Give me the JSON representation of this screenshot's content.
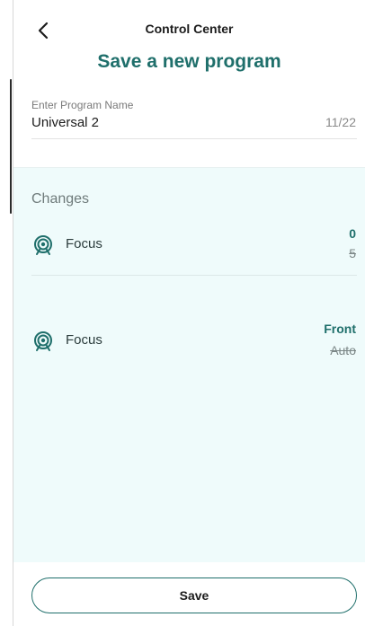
{
  "header": {
    "back_icon": "chevron-left-icon",
    "nav_title": "Control Center",
    "page_title": "Save a new program"
  },
  "program_name": {
    "label": "Enter Program Name",
    "value": "Universal 2",
    "counter": "11/22"
  },
  "changes": {
    "heading": "Changes",
    "items": [
      {
        "icon": "focus-icon",
        "label": "Focus",
        "new_value": "0",
        "old_value": "5"
      },
      {
        "icon": "focus-icon",
        "label": "Focus",
        "new_value": "Front",
        "old_value": "Auto"
      }
    ]
  },
  "footer": {
    "save_label": "Save"
  },
  "colors": {
    "accent": "#1f6f6b",
    "panel_background": "#effbfb",
    "text_primary": "#1c1c1c",
    "text_muted": "#7a7a7a"
  }
}
